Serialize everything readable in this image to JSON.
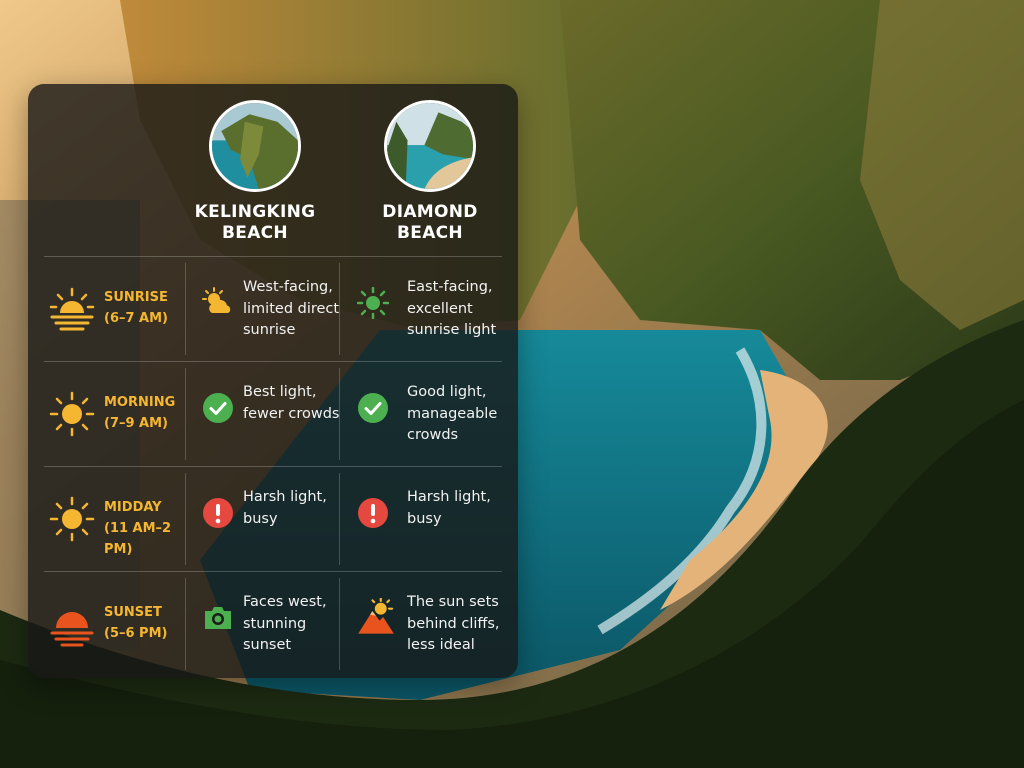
{
  "beaches": [
    {
      "name_line1": "KELINGKING",
      "name_line2": "BEACH"
    },
    {
      "name_line1": "DIAMOND",
      "name_line2": "BEACH"
    }
  ],
  "rows": [
    {
      "time": "SUNRISE",
      "range": "(6–7 AM)",
      "time_icon": "sunrise-icon",
      "kelingking": {
        "icon": "partly-cloudy-icon",
        "lines": [
          "West-facing,",
          "limited direct",
          "sunrise"
        ]
      },
      "diamond": {
        "icon": "green-sun-icon",
        "lines": [
          "East-facing,",
          "excellent",
          "sunrise light"
        ]
      }
    },
    {
      "time": "MORNING",
      "range": "(7–9 AM)",
      "time_icon": "sun-icon",
      "kelingking": {
        "icon": "check-icon",
        "lines": [
          "Best light,",
          "fewer crowds"
        ]
      },
      "diamond": {
        "icon": "check-icon",
        "lines": [
          "Good light,",
          "manageable",
          "crowds"
        ]
      }
    },
    {
      "time": "MIDDAY",
      "range": "(11 AM–2 PM)",
      "time_icon": "sun-icon",
      "kelingking": {
        "icon": "alert-icon",
        "lines": [
          "Harsh light,",
          "busy"
        ]
      },
      "diamond": {
        "icon": "alert-icon",
        "lines": [
          "Harsh light,",
          "busy"
        ]
      }
    },
    {
      "time": "SUNSET",
      "range": "(5–6 PM)",
      "time_icon": "sunset-icon",
      "kelingking": {
        "icon": "camera-icon",
        "lines": [
          "Faces west,",
          "stunning",
          "sunset"
        ]
      },
      "diamond": {
        "icon": "sun-behind-mountain-icon",
        "lines": [
          "The sun sets",
          "behind cliffs,",
          "less ideal"
        ]
      }
    }
  ],
  "colors": {
    "label": "#f5b731",
    "green": "#4caf50",
    "red": "#e5483f",
    "sunset": "#e8531e"
  }
}
